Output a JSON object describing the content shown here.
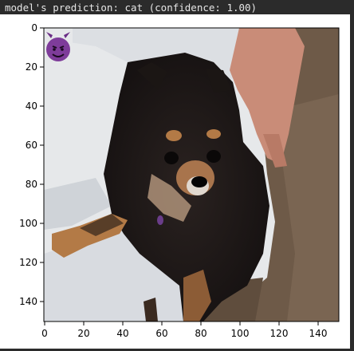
{
  "output": {
    "title": "model's prediction: cat (confidence: 1.00)"
  },
  "figure": {
    "image_description": "A small black-and-tan long-haired dog sitting on a white blanket next to a brown couch, with a human hand resting on its back; a small purple devil emoji sits in the top-left corner.",
    "overlay_icon": "devil-emoji-icon",
    "x_ticks": [
      "0",
      "20",
      "40",
      "60",
      "80",
      "100",
      "120",
      "140"
    ],
    "y_ticks": [
      "0",
      "20",
      "40",
      "60",
      "80",
      "100",
      "120",
      "140"
    ],
    "xlim": [
      0,
      150
    ],
    "ylim": [
      150,
      0
    ]
  },
  "colors": {
    "background": "#2b2b2b",
    "title_text": "#e6e6e6",
    "axes": "#000000",
    "blanket": "#e6e8ea",
    "couch": "#6e5a48",
    "dog_fur": "#1b1614",
    "dog_tan": "#b37a46",
    "hand": "#c98c78",
    "emoji_purple": "#7e3c9a"
  }
}
